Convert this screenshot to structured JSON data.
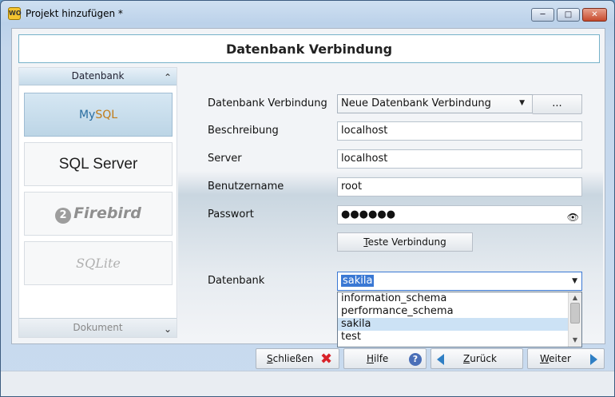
{
  "window": {
    "title": "Projekt hinzufügen *",
    "app_icon_text": "WO",
    "controls": {
      "minimize": "─",
      "maximize": "□",
      "close": "✕"
    }
  },
  "header": {
    "title": "Datenbank Verbindung"
  },
  "left_panel": {
    "section_label": "Datenbank",
    "section_chevron": "chevron-up-icon",
    "databases": [
      {
        "name": "MySQL",
        "logo_text_a": "My",
        "logo_text_b": "SQL",
        "selected": true
      },
      {
        "name": "SQL Server",
        "selected": false
      },
      {
        "name": "Firebird",
        "selected": false
      },
      {
        "name": "SQLite",
        "selected": false
      }
    ],
    "footer_label": "Dokument",
    "footer_chevron": "chevron-down-icon"
  },
  "form": {
    "connection_label": "Datenbank Verbindung",
    "connection_value": "Neue Datenbank Verbindung",
    "ellipsis_button": "...",
    "description_label": "Beschreibung",
    "description_value": "localhost",
    "server_label": "Server",
    "server_value": "localhost",
    "username_label": "Benutzername",
    "username_value": "root",
    "password_label": "Passwort",
    "password_value": "●●●●●●",
    "password_eye_icon": "eye-icon",
    "test_button_u": "T",
    "test_button_rest": "este Verbindung",
    "database_label": "Datenbank",
    "database_value": "sakila",
    "database_options": [
      "information_schema",
      "performance_schema",
      "sakila",
      "test"
    ],
    "database_highlighted": "sakila"
  },
  "footer": {
    "close_u": "S",
    "close_rest": "chließen",
    "help_u": "H",
    "help_rest": "ilfe",
    "back_u": "Z",
    "back_rest": "urück",
    "next_u": "W",
    "next_rest": "eiter"
  },
  "colors": {
    "header_border": "#76b2c9",
    "selected_tile": "#c6dcec",
    "selection_blue": "#3a78d4",
    "close_icon": "#d8232a",
    "nav_arrow": "#2f7fc4"
  }
}
